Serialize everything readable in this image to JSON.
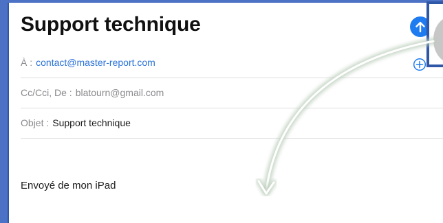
{
  "compose": {
    "title": "Support technique",
    "to_label": "À :",
    "to_value": "contact@master-report.com",
    "cc_label": "Cc/Cci, De :",
    "cc_value": "blatourn@gmail.com",
    "subject_label": "Objet :",
    "subject_value": "Support technique",
    "body": "Envoyé de mon iPad"
  },
  "icons": {
    "send": "arrow-up-icon",
    "add_recipient": "plus-circle-icon"
  },
  "colors": {
    "accent": "#1f7cf0",
    "link": "#2a72d8",
    "frame": "#4b72c4",
    "arrow": "#6e8f6f"
  }
}
